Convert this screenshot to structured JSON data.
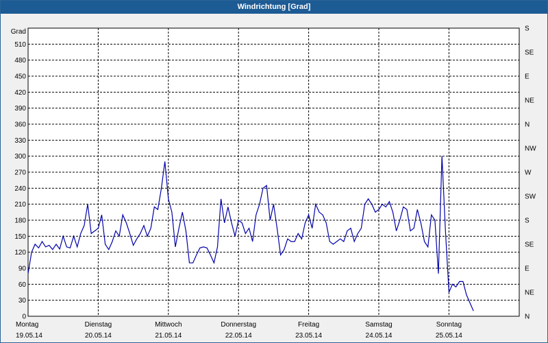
{
  "window": {
    "title": "Windrichtung [Grad]"
  },
  "chart_data": {
    "type": "line",
    "title": "Windrichtung [Grad]",
    "ylabel": "Grad",
    "ylim": [
      0,
      540
    ],
    "yticks": [
      0,
      30,
      60,
      90,
      120,
      150,
      180,
      210,
      240,
      270,
      300,
      330,
      360,
      390,
      420,
      450,
      480,
      510
    ],
    "y2_labels": [
      "N",
      "NE",
      "E",
      "SE",
      "S",
      "SW",
      "W",
      "NW",
      "N",
      "NE",
      "E",
      "SE",
      "S"
    ],
    "x_days": [
      {
        "day": "Montag",
        "date": "19.05.14"
      },
      {
        "day": "Dienstag",
        "date": "20.05.14"
      },
      {
        "day": "Mittwoch",
        "date": "21.05.14"
      },
      {
        "day": "Donnerstag",
        "date": "22.05.14"
      },
      {
        "day": "Freitag",
        "date": "23.05.14"
      },
      {
        "day": "Samstag",
        "date": "24.05.14"
      },
      {
        "day": "Sonntag",
        "date": "25.05.14"
      }
    ],
    "grid": true,
    "series": [
      {
        "color": "#0000aa",
        "x_days": [
          0.0,
          0.05,
          0.1,
          0.15,
          0.2,
          0.25,
          0.3,
          0.35,
          0.4,
          0.45,
          0.5,
          0.55,
          0.6,
          0.65,
          0.7,
          0.75,
          0.8,
          0.85,
          0.9,
          0.95,
          1.0,
          1.05,
          1.1,
          1.15,
          1.2,
          1.25,
          1.3,
          1.35,
          1.4,
          1.45,
          1.5,
          1.55,
          1.6,
          1.65,
          1.7,
          1.75,
          1.8,
          1.85,
          1.9,
          1.95,
          2.0,
          2.05,
          2.1,
          2.15,
          2.2,
          2.25,
          2.3,
          2.35,
          2.4,
          2.45,
          2.5,
          2.55,
          2.6,
          2.65,
          2.7,
          2.75,
          2.8,
          2.85,
          2.9,
          2.95,
          3.0,
          3.05,
          3.1,
          3.15,
          3.2,
          3.25,
          3.3,
          3.35,
          3.4,
          3.45,
          3.5,
          3.55,
          3.6,
          3.65,
          3.7,
          3.75,
          3.8,
          3.85,
          3.9,
          3.95,
          4.0,
          4.05,
          4.1,
          4.15,
          4.2,
          4.25,
          4.3,
          4.35,
          4.4,
          4.45,
          4.5,
          4.55,
          4.6,
          4.65,
          4.7,
          4.75,
          4.8,
          4.85,
          4.9,
          4.95,
          5.0,
          5.05,
          5.1,
          5.15,
          5.2,
          5.25,
          5.3,
          5.35,
          5.4,
          5.45,
          5.5,
          5.55,
          5.6,
          5.65,
          5.7,
          5.75,
          5.8,
          5.85,
          5.9,
          5.95,
          6.0,
          6.05,
          6.1,
          6.15,
          6.2,
          6.25,
          6.3,
          6.35,
          6.4,
          6.45,
          6.5,
          6.55,
          6.6,
          6.65,
          6.7,
          6.75,
          6.8,
          6.85,
          6.9,
          6.95,
          7.0
        ],
        "y": [
          80,
          120,
          135,
          128,
          140,
          130,
          133,
          125,
          135,
          126,
          150,
          130,
          128,
          150,
          130,
          155,
          170,
          210,
          155,
          160,
          165,
          190,
          135,
          125,
          140,
          160,
          150,
          190,
          175,
          155,
          133,
          145,
          155,
          170,
          150,
          165,
          205,
          200,
          240,
          290,
          220,
          195,
          130,
          165,
          195,
          160,
          100,
          100,
          115,
          128,
          130,
          128,
          115,
          100,
          130,
          220,
          175,
          205,
          175,
          150,
          180,
          175,
          155,
          165,
          140,
          190,
          210,
          240,
          245,
          180,
          210,
          165,
          115,
          125,
          145,
          140,
          140,
          155,
          145,
          175,
          190,
          165,
          210,
          195,
          190,
          175,
          140,
          135,
          140,
          145,
          140,
          160,
          165,
          140,
          155,
          165,
          210,
          220,
          210,
          195,
          200,
          210,
          205,
          215,
          195,
          160,
          180,
          205,
          200,
          160,
          165,
          200,
          175,
          140,
          130,
          190,
          180,
          80,
          300,
          160,
          45,
          60,
          55,
          65,
          65,
          40,
          25,
          10
        ]
      }
    ]
  }
}
